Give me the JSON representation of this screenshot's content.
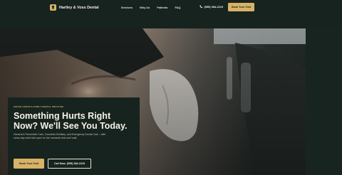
{
  "header": {
    "brand": "Hartley & Voss Dental",
    "nav": [
      "Services",
      "Why Us",
      "Patients",
      "FAQ"
    ],
    "phone": "(555) 384-2219",
    "cta": "Book Your Visit"
  },
  "hero": {
    "eyebrow": "CEDAR GROVE'S FAMILY DENTAL PRACTICE",
    "headline": "Something Hurts Right Now? We'll See You Today.",
    "description": "General & Preventive Care, Cosmetic Dentistry, and Emergency Dental Care – with same-day slots held open for the moments that can't wait.",
    "primary_cta": "Book Your Visit",
    "secondary_cta": "Call Now: (555) 384-2219"
  },
  "colors": {
    "background": "#17231e",
    "accent": "#d8b267",
    "text": "#f3efe6"
  },
  "icons": {
    "logo": "tooth-icon",
    "phone": "phone-icon"
  }
}
